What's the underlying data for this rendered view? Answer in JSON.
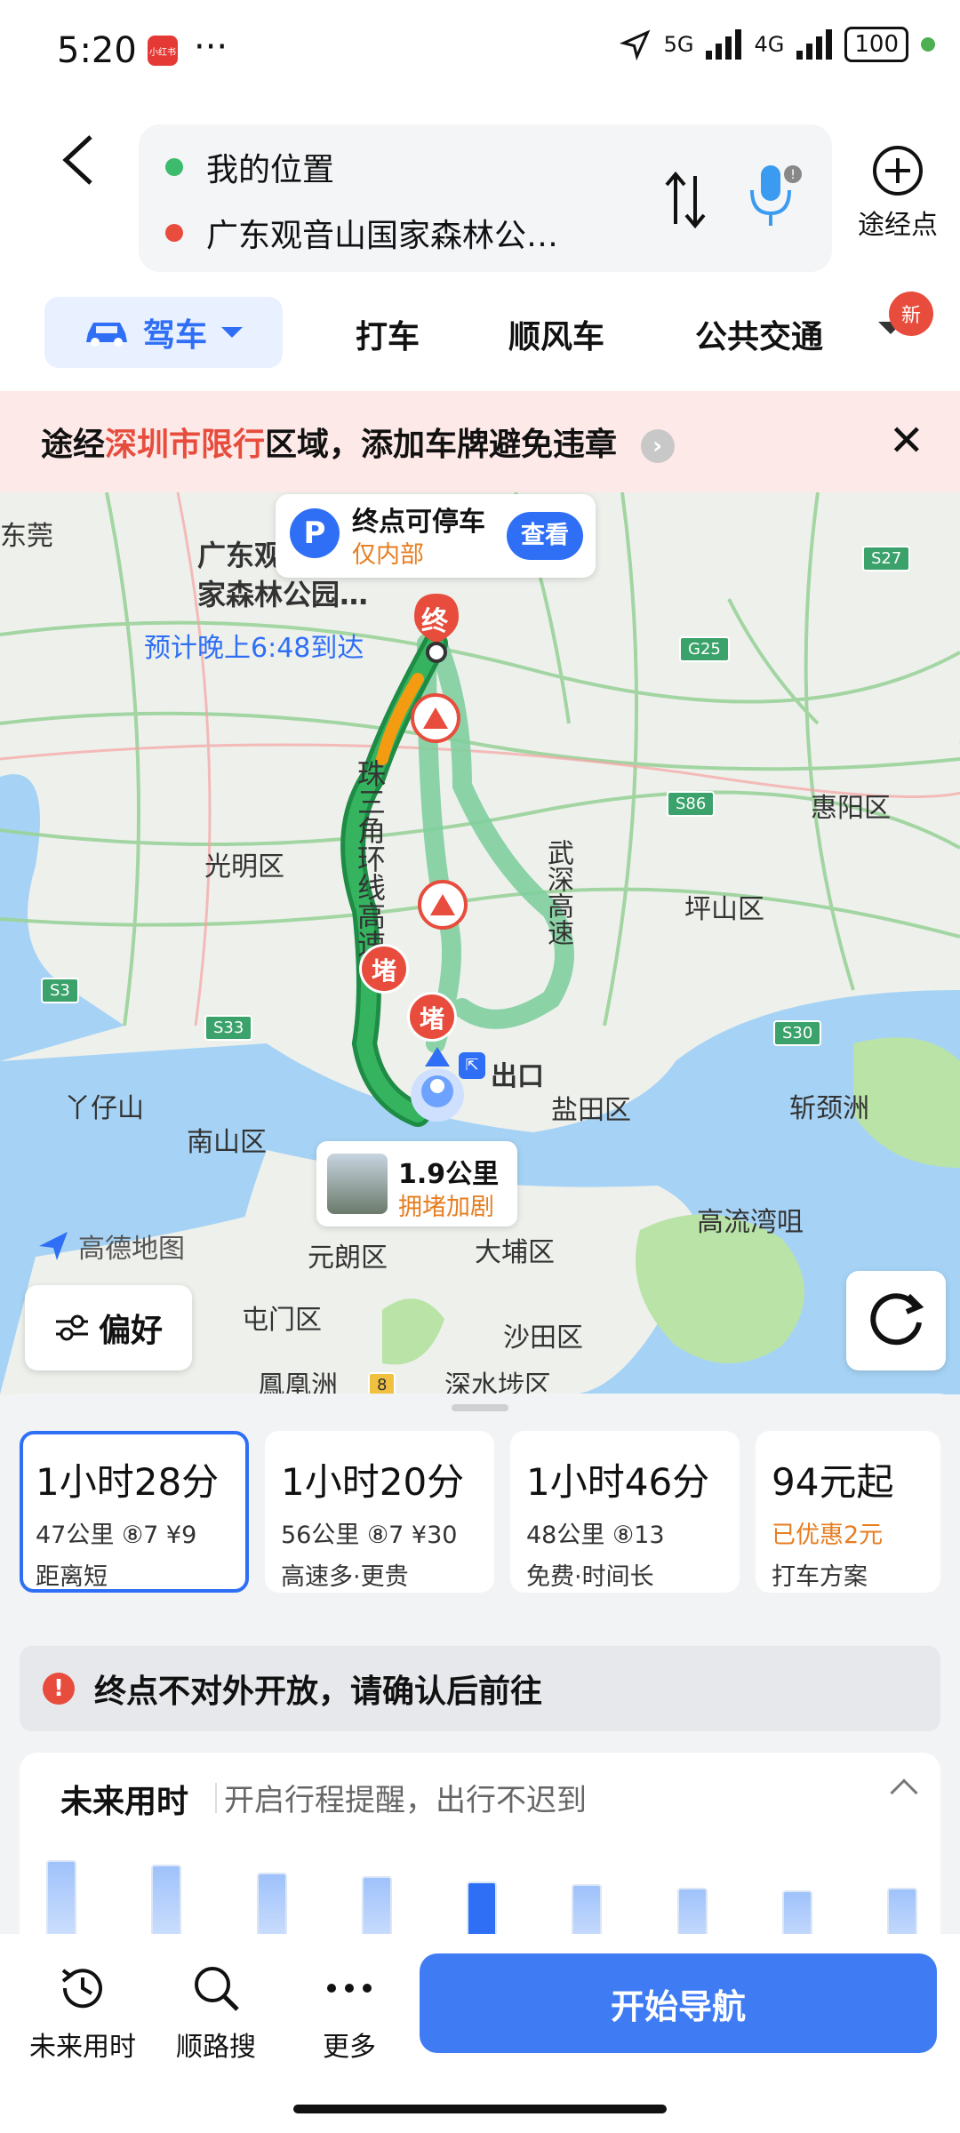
{
  "status": {
    "time": "5:20",
    "app_icon_text": "小红书",
    "dots": "···",
    "signal_5g": "5G",
    "signal_4g": "4G",
    "battery": "100"
  },
  "search": {
    "origin": "我的位置",
    "destination": "广东观音山国家森林公…",
    "waypoint_label": "途经点"
  },
  "tabs": {
    "drive": "驾车",
    "taxi": "打车",
    "carpool": "顺风车",
    "transit": "公共交通",
    "new_badge": "新"
  },
  "banner": {
    "prefix": "途经",
    "highlight": "深圳市限行",
    "suffix": "区域，添加车牌避免违章"
  },
  "map": {
    "dest_name_line1": "广东观",
    "dest_name_line2": "家森林公园…",
    "eta": "预计晚上6:48到达",
    "dest_marker": "终",
    "parking": {
      "icon": "P",
      "title": "终点可停车",
      "sub": "仅内部",
      "button": "查看"
    },
    "jam_markers": [
      "堵",
      "堵"
    ],
    "exit_label": "出口",
    "traffic": {
      "distance": "1.9公里",
      "status": "拥堵加剧"
    },
    "logo": "高德地图",
    "places": [
      "东莞",
      "光明区",
      "惠阳区",
      "坪山区",
      "丫仔山",
      "南山区",
      "盐田区",
      "斩颈洲",
      "高流湾咀",
      "元朗区",
      "大埔区",
      "屯门区",
      "沙田区",
      "鳳凰洲",
      "深水埗区"
    ],
    "road_names": {
      "left": "珠三角环线高速",
      "right": "武深高速"
    },
    "highways": [
      "S27",
      "G25",
      "S86",
      "S3",
      "S33",
      "S30",
      "8"
    ],
    "pref_button": "偏好"
  },
  "routes": [
    {
      "time": "1小时28分",
      "info": "47公里  ⑧7  ¥9",
      "tag": "距离短",
      "tag_color": "normal"
    },
    {
      "time": "1小时20分",
      "info": "56公里  ⑧7  ¥30",
      "tag": "高速多·更贵",
      "tag_color": "normal"
    },
    {
      "time": "1小时46分",
      "info": "48公里  ⑧13",
      "tag": "免费·时间长",
      "tag_color": "normal"
    },
    {
      "time": "94元起",
      "info": "已优惠2元",
      "tag": "打车方案",
      "tag_color": "orange"
    }
  ],
  "notice": "终点不对外开放，请确认后前往",
  "future": {
    "title": "未来用时",
    "subtitle": "开启行程提醒，出行不迟到",
    "bar_levels": [
      0.85,
      0.82,
      0.76,
      0.74,
      0.7,
      0.68,
      0.66,
      0.64,
      0.66
    ],
    "selected_index": 4
  },
  "nav": {
    "future_time": "未来用时",
    "along_search": "顺路搜",
    "more": "更多",
    "start": "开始导航"
  },
  "colors": {
    "accent": "#2f6ff6",
    "jam_red": "#e74c3c",
    "route_green": "#3aa26a",
    "warning_orange": "#e67e22"
  }
}
